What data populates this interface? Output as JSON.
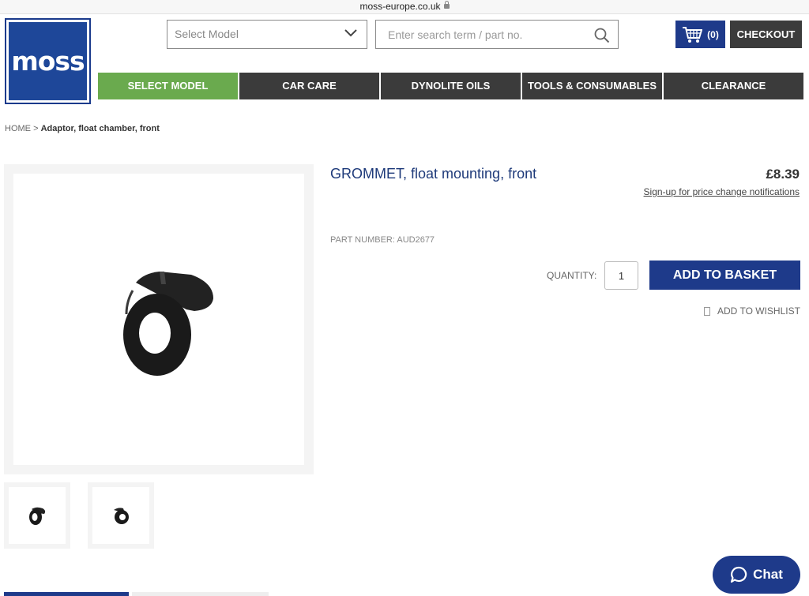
{
  "browser": {
    "url": "moss-europe.co.uk"
  },
  "logo": {
    "text": "moss"
  },
  "header": {
    "model_select_placeholder": "Select Model",
    "search_placeholder": "Enter search term / part no.",
    "cart_count": "(0)",
    "checkout_label": "CHECKOUT"
  },
  "nav": {
    "items": [
      {
        "label": "SELECT MODEL",
        "active": true
      },
      {
        "label": "CAR CARE"
      },
      {
        "label": "DYNOLITE OILS"
      },
      {
        "label": "TOOLS & CONSUMABLES"
      },
      {
        "label": "CLEARANCE"
      }
    ]
  },
  "breadcrumb": {
    "home": "HOME",
    "separator": ">",
    "current": "Adaptor, float chamber, front"
  },
  "product": {
    "title": "GROMMET, float mounting, front",
    "price": "£8.39",
    "price_notification": "Sign-up for price change notifications",
    "part_number": "PART NUMBER: AUD2677",
    "quantity_label": "QUANTITY:",
    "quantity_value": "1",
    "add_to_basket": "ADD TO BASKET",
    "wishlist": "ADD TO WISHLIST"
  },
  "chat": {
    "label": "Chat"
  },
  "colors": {
    "brand_blue": "#1e3a8a",
    "nav_dark": "#3b3b3b",
    "nav_active_green": "#6aaa4e",
    "title_blue": "#1e3a7a"
  }
}
